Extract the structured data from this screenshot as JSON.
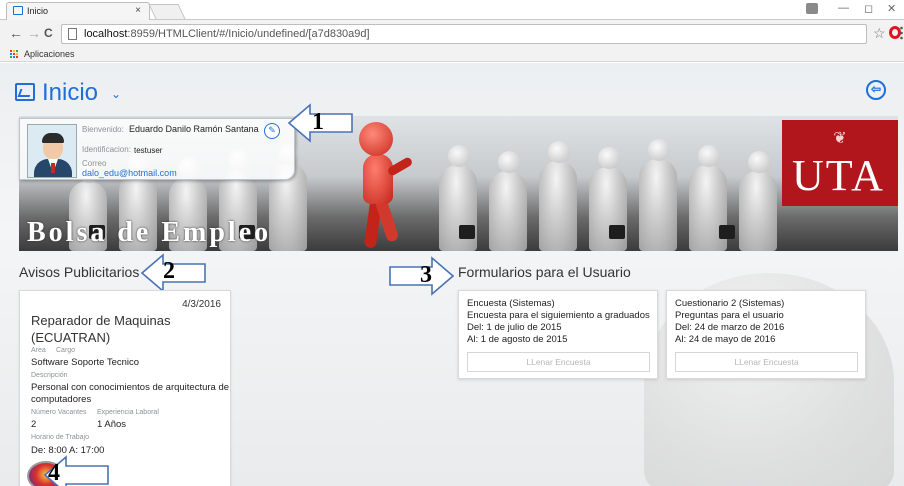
{
  "browser": {
    "tab_title": "Inicio",
    "tab_close": "×",
    "window_controls": [
      "—",
      "◻",
      "✕"
    ],
    "url_host": "localhost",
    "url_rest": ":8959/HTMLClient/#/Inicio/undefined/[a7d830a9d]",
    "bookmarks_label": "Aplicaciones",
    "nav": {
      "back": "←",
      "forward": "→",
      "reload": "C"
    },
    "star": "☆",
    "colors": {
      "opera": "#e0141e",
      "apps": [
        "#e53935",
        "#fbc02d",
        "#43a047",
        "#1e88e5"
      ]
    }
  },
  "header": {
    "title": "Inicio",
    "chevron": "⌄",
    "logout_glyph": "⇦",
    "accent": "#1e6fd8"
  },
  "banner": {
    "caption": "Bolsa de Empleo",
    "logo_text": "UTA",
    "logo_emblem": "❦",
    "logo_color": "#b0161b"
  },
  "user_card": {
    "welcome_label": "Bienvenido:",
    "name": "Eduardo Danilo Ramón Santana",
    "id_label": "Identificacion:",
    "id_value": "testuser",
    "email_label": "Correo",
    "email": "dalo_edu@hotmail.com",
    "edit_glyph": "✎"
  },
  "annotations": [
    "1",
    "2",
    "3",
    "4"
  ],
  "sections": {
    "ads_title": "Avisos Publicitarios",
    "forms_title": "Formularios para el Usuario"
  },
  "ad": {
    "date": "4/3/2016",
    "title": "Reparador de Maquinas (ECUATRAN)",
    "area_label": "Area",
    "cargo_label": "Cargo",
    "cargo": "Software Soporte Tecnico",
    "desc_label": "Descripción",
    "desc_line1": "Personal con conocimientos de arquitectura de",
    "desc_line2": "computadores",
    "vacancies_label": "Número Vacantes",
    "experience_label": "Experiencia Laboral",
    "vacancies": "2",
    "experience": "1 Años",
    "schedule_label": "Horario de Trabajo",
    "schedule": "De: 8:00 A: 17:00"
  },
  "forms": [
    {
      "title": "Encuesta (Sistemas)",
      "subtitle": "Encuesta para el siguiemiento a graduados",
      "from": "Del: 1 de julio de 2015",
      "to": "Al: 1 de agosto de 2015",
      "button": "LLenar Encuesta"
    },
    {
      "title": "Cuestionario 2 (Sistemas)",
      "subtitle": "Preguntas para el usuario",
      "from": "Del: 24 de marzo de 2016",
      "to": "Al: 24 de mayo de 2016",
      "button": "LLenar Encuesta"
    }
  ]
}
